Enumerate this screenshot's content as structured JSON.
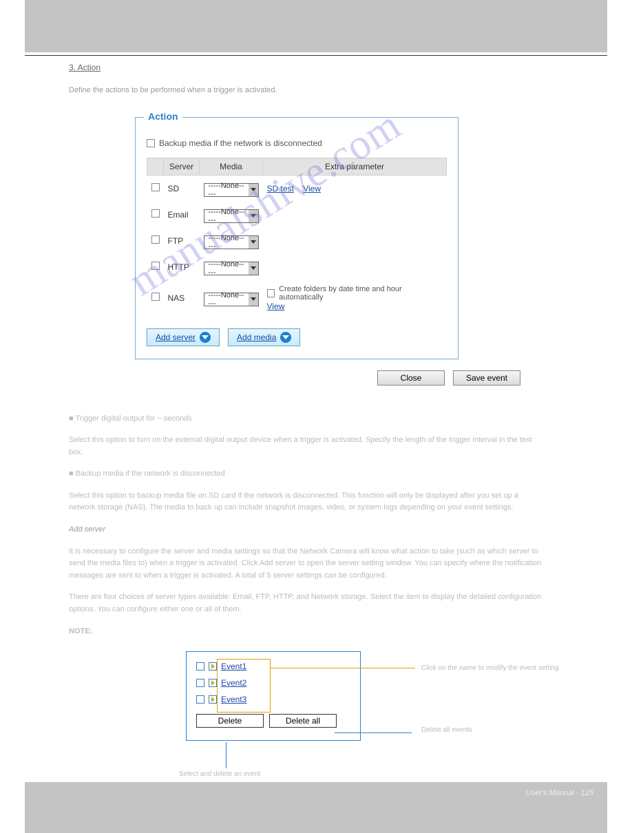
{
  "section_link": "3. Action",
  "intro": "Define the actions to be performed when a trigger is activated.",
  "fieldset_title": "Action",
  "backup_label": "Backup media if the network is disconnected",
  "headers": {
    "server": "Server",
    "media": "Media",
    "extra": "Extra parameter"
  },
  "rows": {
    "sd": {
      "name": "SD",
      "sel": "-----None-----",
      "link1": "SD test",
      "link2": "View"
    },
    "email": {
      "name": "Email",
      "sel": "-----None-----"
    },
    "ftp": {
      "name": "FTP",
      "sel": "-----None-----"
    },
    "http": {
      "name": "HTTP",
      "sel": "-----None-----"
    },
    "nas": {
      "name": "NAS",
      "sel": "-----None-----",
      "auto": "Create folders by date time and hour automatically",
      "view": "View"
    }
  },
  "add_server": "Add server",
  "add_media": "Add media",
  "close_btn": "Close",
  "save_btn": "Save event",
  "mid": {
    "p1": "■ Trigger digital output for ~ seconds",
    "p1b": "Select this option to turn on the external digital output device when a trigger is activated. Specify the length of the trigger interval in the text box.",
    "p2": "■ Backup media if the network is disconnected",
    "p2b": "Select this option to backup media file on SD card if the network is disconnected. This function will only be displayed after you set up a network storage (NAS).  The media to back up can include snapshot images, video, or system logs depending on your event settings.",
    "p3": "Add server",
    "p3b": "It is necessary to configure the server and media settings so that the Network Camera will know what action to take (such as which server to send the media files to) when a trigger is activated. Click Add server to open the server setting window. You can specify where the notification messages are sent to when a trigger is activated. A total of 5 server settings can be configured.",
    "p4": "There are four choices of server types available: Email, FTP, HTTP, and Network storage. Select the item to display the detailed configuration options. You can configure either one or all of them.",
    "note": "NOTE:"
  },
  "event_rows": [
    "Event1",
    "Event2",
    "Event3"
  ],
  "delete": "Delete",
  "delete_all": "Delete all",
  "ann1": "Click on the name to modify the event setting",
  "ann2": "Delete all events",
  "ann3": "Select and delete an event",
  "footer_page": "User's Manual - 125",
  "footer_title": "",
  "watermark": "manualshive.com"
}
